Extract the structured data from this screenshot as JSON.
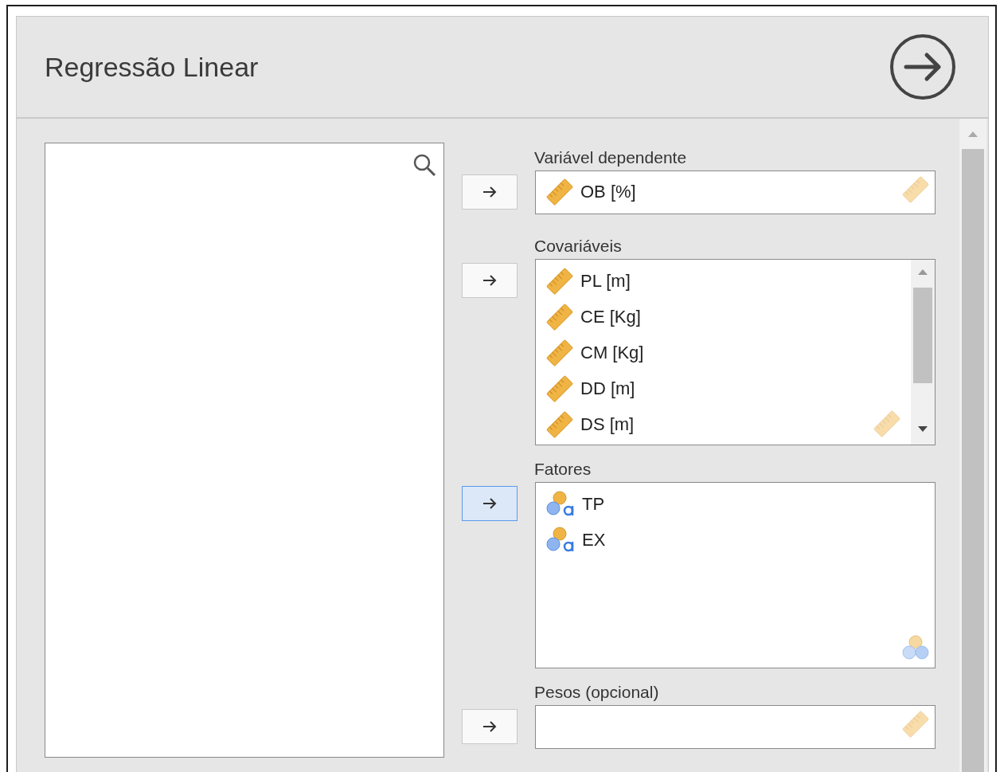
{
  "title": "Regressão Linear",
  "sections": [
    {
      "label": "Variável dependente",
      "kind": "scale_field",
      "button_selected": false,
      "items": [
        {
          "name": "OB [%]",
          "kind": "scale"
        }
      ]
    },
    {
      "label": "Covariáveis",
      "kind": "scale_list",
      "button_selected": false,
      "items": [
        {
          "name": "PL [m]",
          "kind": "scale"
        },
        {
          "name": "CE [Kg]",
          "kind": "scale"
        },
        {
          "name": "CM [Kg]",
          "kind": "scale"
        },
        {
          "name": "DD [m]",
          "kind": "scale"
        },
        {
          "name": "DS [m]",
          "kind": "scale"
        }
      ],
      "scrollable": true
    },
    {
      "label": "Fatores",
      "kind": "nominal_list",
      "button_selected": true,
      "items": [
        {
          "name": "TP",
          "kind": "nominal"
        },
        {
          "name": "EX",
          "kind": "nominal"
        }
      ]
    },
    {
      "label": "Pesos (opcional)",
      "kind": "scale_field",
      "button_selected": false
    }
  ]
}
